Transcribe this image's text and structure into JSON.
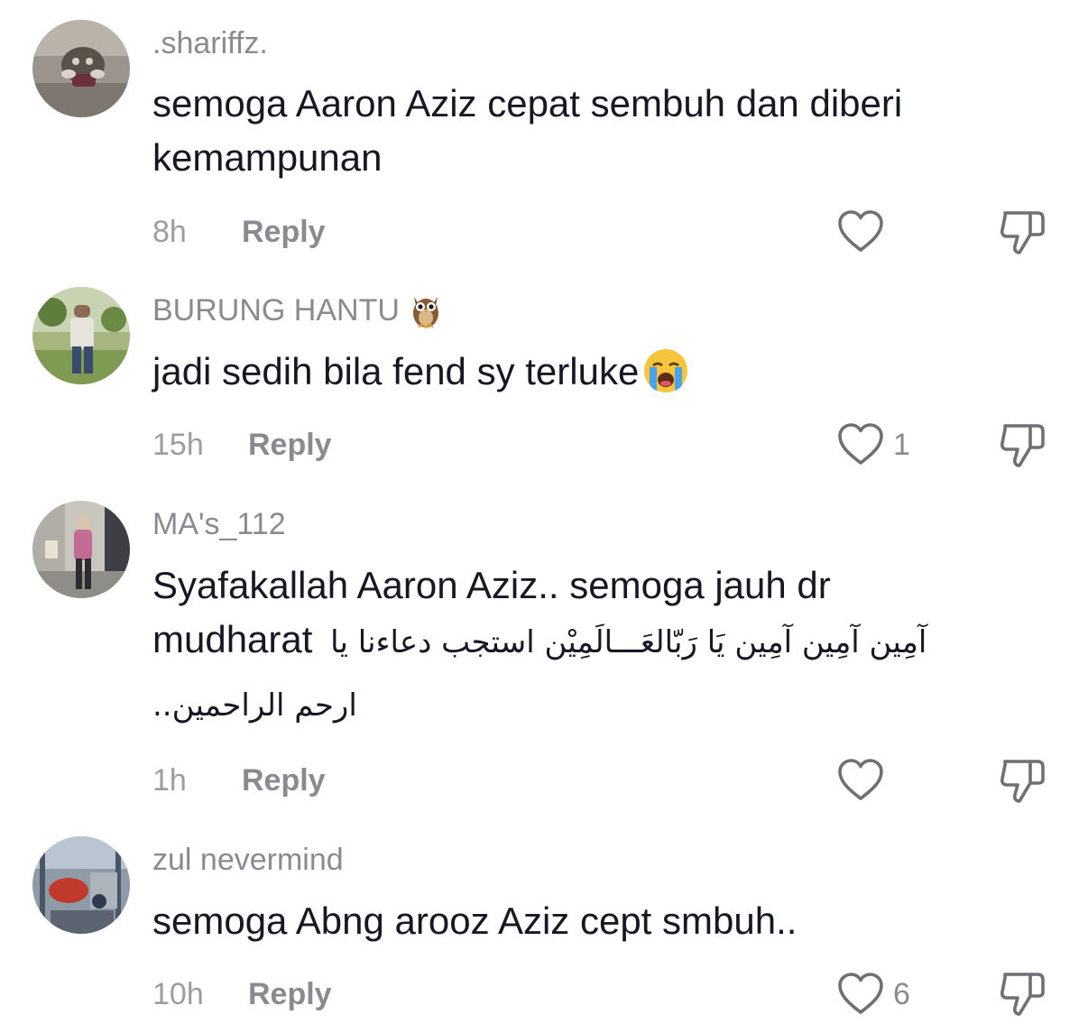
{
  "comments": [
    {
      "username": ".shariffz.",
      "text_lines": [
        "semoga Aaron Aziz cepat sembuh dan diberi",
        "kemampunan"
      ],
      "time": "8h",
      "reply_label": "Reply",
      "likes": ""
    },
    {
      "username": "BURUNG HANTU",
      "username_emoji": "owl-emoji",
      "text_lines": [
        "jadi sedih bila fend sy terluke"
      ],
      "text_emoji": "loudly-crying-face-emoji",
      "time": "15h",
      "reply_label": "Reply",
      "likes": "1"
    },
    {
      "username": "MA's_112",
      "text_line_1": "Syafakallah Aaron Aziz.. semoga jauh dr",
      "text_line_2_latin": "mudharat",
      "text_line_2_arabic": "آمِين آمِين آمِين يَا رَبّالعَـــالَمِيْن استجب دعاءنا يا",
      "text_line_3": "ارحم الراحمين..",
      "time": "1h",
      "reply_label": "Reply",
      "likes": ""
    },
    {
      "username": "zul nevermind",
      "text_lines": [
        "semoga Abng arooz Aziz cept smbuh.."
      ],
      "time": "10h",
      "reply_label": "Reply",
      "likes": "6"
    }
  ],
  "icons": {
    "like": "heart-outline-icon",
    "dislike": "thumbs-down-outline-icon"
  },
  "colors": {
    "text": "#161823",
    "muted": "#8a8b91",
    "icon": "#6f7075"
  }
}
